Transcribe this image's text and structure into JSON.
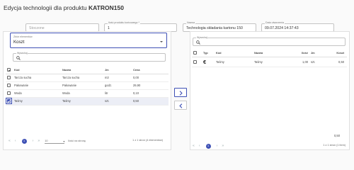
{
  "header": {
    "title_prefix": "Edycja technologii dla produktu ",
    "product": "KATRON150"
  },
  "top_fields": {
    "placeholder": "Stoczone",
    "product_count": {
      "label": "Ilość produktu końcowego *",
      "value": "1"
    },
    "name": {
      "label": "Nazwa",
      "value": "Technologia składania kartonu 150"
    },
    "date": {
      "label": "Data utworzenia",
      "value": "09.07.2024 14:37:43"
    }
  },
  "left_panel": {
    "select": {
      "label": "Zbiór elementów",
      "value": "Koszt"
    },
    "search_label": "Wyszukaj",
    "columns": {
      "kod": "Kod",
      "nazwa": "Nazwa",
      "jm": "Jm",
      "cena": "Cena"
    },
    "rows": [
      {
        "kod": "Tarcza sucha",
        "nazwa": "Tarcza sucha",
        "jm": "m3",
        "cena": "0,00",
        "checked": false
      },
      {
        "kod": "Pakowanie",
        "nazwa": "Pakowanie",
        "jm": "godz.",
        "cena": "29,90",
        "checked": false
      },
      {
        "kod": "Woda",
        "nazwa": "Woda",
        "jm": "litr",
        "cena": "0,10",
        "checked": false
      },
      {
        "kod": "Taśmy",
        "nazwa": "Taśmy",
        "jm": "szt.",
        "cena": "0,50",
        "checked": true
      }
    ],
    "pager": {
      "prev2": "«",
      "prev": "‹",
      "page": "1",
      "next": "›",
      "next2": "»",
      "size": "10",
      "size_label": "Ilość na stronę",
      "range": "1 z 1 stron (4 elementów)"
    }
  },
  "right_panel": {
    "search_label": "Wyszukaj",
    "columns": {
      "typ": "Typ",
      "kod": "Kod",
      "nazwa": "Nazwa",
      "ilosc": "Ilość",
      "jm": "Jm",
      "koszt": "Koszt"
    },
    "rows": [
      {
        "typ_icon": "€",
        "kod": "Taśmy",
        "nazwa": "Taśmy",
        "ilosc": "1,00",
        "jm": "szt.",
        "koszt": "0,50"
      }
    ],
    "total": "0,50",
    "pager": {
      "prev2": "«",
      "prev": "‹",
      "page": "1",
      "next": "›",
      "next2": "»",
      "range": "1 z 1 stron (1 item)"
    }
  },
  "transfer": {
    "add_icon": "chevron-right-icon",
    "remove_icon": "chevron-left-icon",
    "accent": "#3f51b5"
  }
}
